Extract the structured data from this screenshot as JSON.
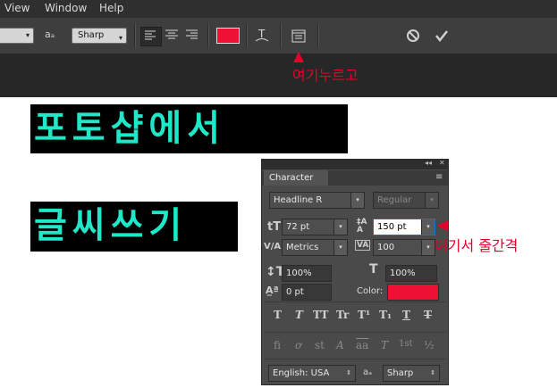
{
  "menubar": {
    "items": [
      "View",
      "Window",
      "Help"
    ]
  },
  "options_bar": {
    "aa_label": "aₐ",
    "antialias": "Sharp",
    "text_color": "#ee1133",
    "cancel_icon": "cancel-icon",
    "commit_icon": "commit-icon"
  },
  "annotations": {
    "top": "여기누르고",
    "leading": "여기서 줄간격"
  },
  "canvas": {
    "line1": "포토샵에서",
    "line2": "글씨쓰기",
    "text_color": "#1ee8c8"
  },
  "character_panel": {
    "tab": "Character",
    "font_family": "Headline R",
    "font_style": "Regular",
    "font_size": "72 pt",
    "leading": "150 pt",
    "kerning": "Metrics",
    "tracking": "100",
    "vertical_scale": "100%",
    "horizontal_scale": "100%",
    "baseline_shift": "0 pt",
    "color_label": "Color:",
    "color": "#ee1133",
    "style_buttons": [
      "T",
      "T",
      "TT",
      "Tr",
      "T¹",
      "T₁",
      "T",
      "T"
    ],
    "opentype_buttons": [
      "fi",
      "ơ",
      "st",
      "A",
      "aa",
      "T",
      "1st",
      "½"
    ],
    "language": "English: USA",
    "aa_label": "aₐ",
    "antialias": "Sharp"
  }
}
